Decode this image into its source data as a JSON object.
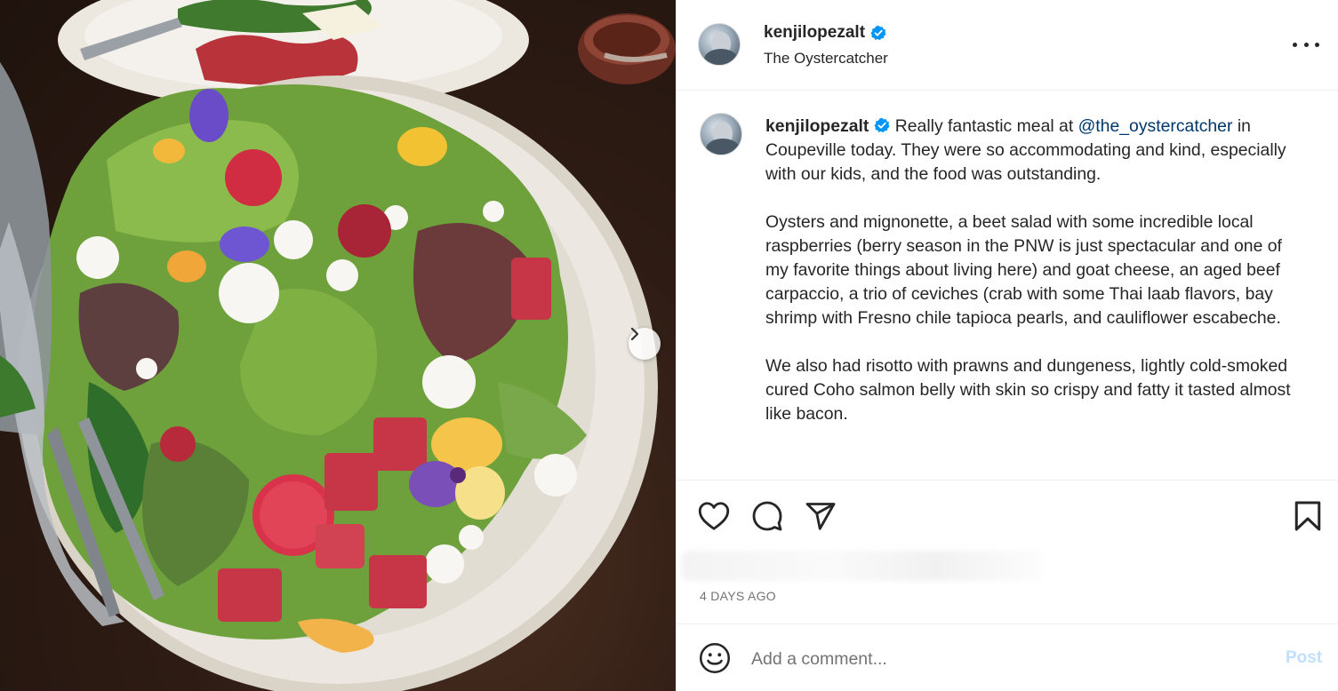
{
  "post": {
    "username": "kenjilopezalt",
    "verified": true,
    "location": "The Oystercatcher",
    "more_icon": "more-horizontal-icon"
  },
  "caption": {
    "username": "kenjilopezalt",
    "p1_before": " Really fantastic meal at ",
    "mention": "@the_oystercatcher",
    "p1_after": " in Coupeville today. They were so accommodating and kind, especially with our kids, and the food was outstanding.",
    "p2": "Oysters and mignonette, a beet salad with some incredible local raspberries (berry season in the PNW is just spectacular and one of my favorite things about living here) and goat cheese, an aged beef carpaccio, a trio of ceviches (crab with some Thai laab flavors, bay shrimp with Fresno chile tapioca pearls, and cauliflower escabeche.",
    "p3": "We also had risotto with prawns and dungeness, lightly cold-smoked cured Coho salmon belly with skin so crispy and fatty it tasted almost like bacon."
  },
  "actions": {
    "like_icon": "heart-icon",
    "comment_icon": "comment-icon",
    "share_icon": "share-icon",
    "save_icon": "bookmark-icon"
  },
  "timestamp": "4 DAYS AGO",
  "comment": {
    "placeholder": "Add a comment...",
    "post_label": "Post",
    "emoji_icon": "emoji-icon"
  },
  "colors": {
    "verified": "#0095f6",
    "mention": "#00376b",
    "post_disabled": "#c0dffd"
  }
}
